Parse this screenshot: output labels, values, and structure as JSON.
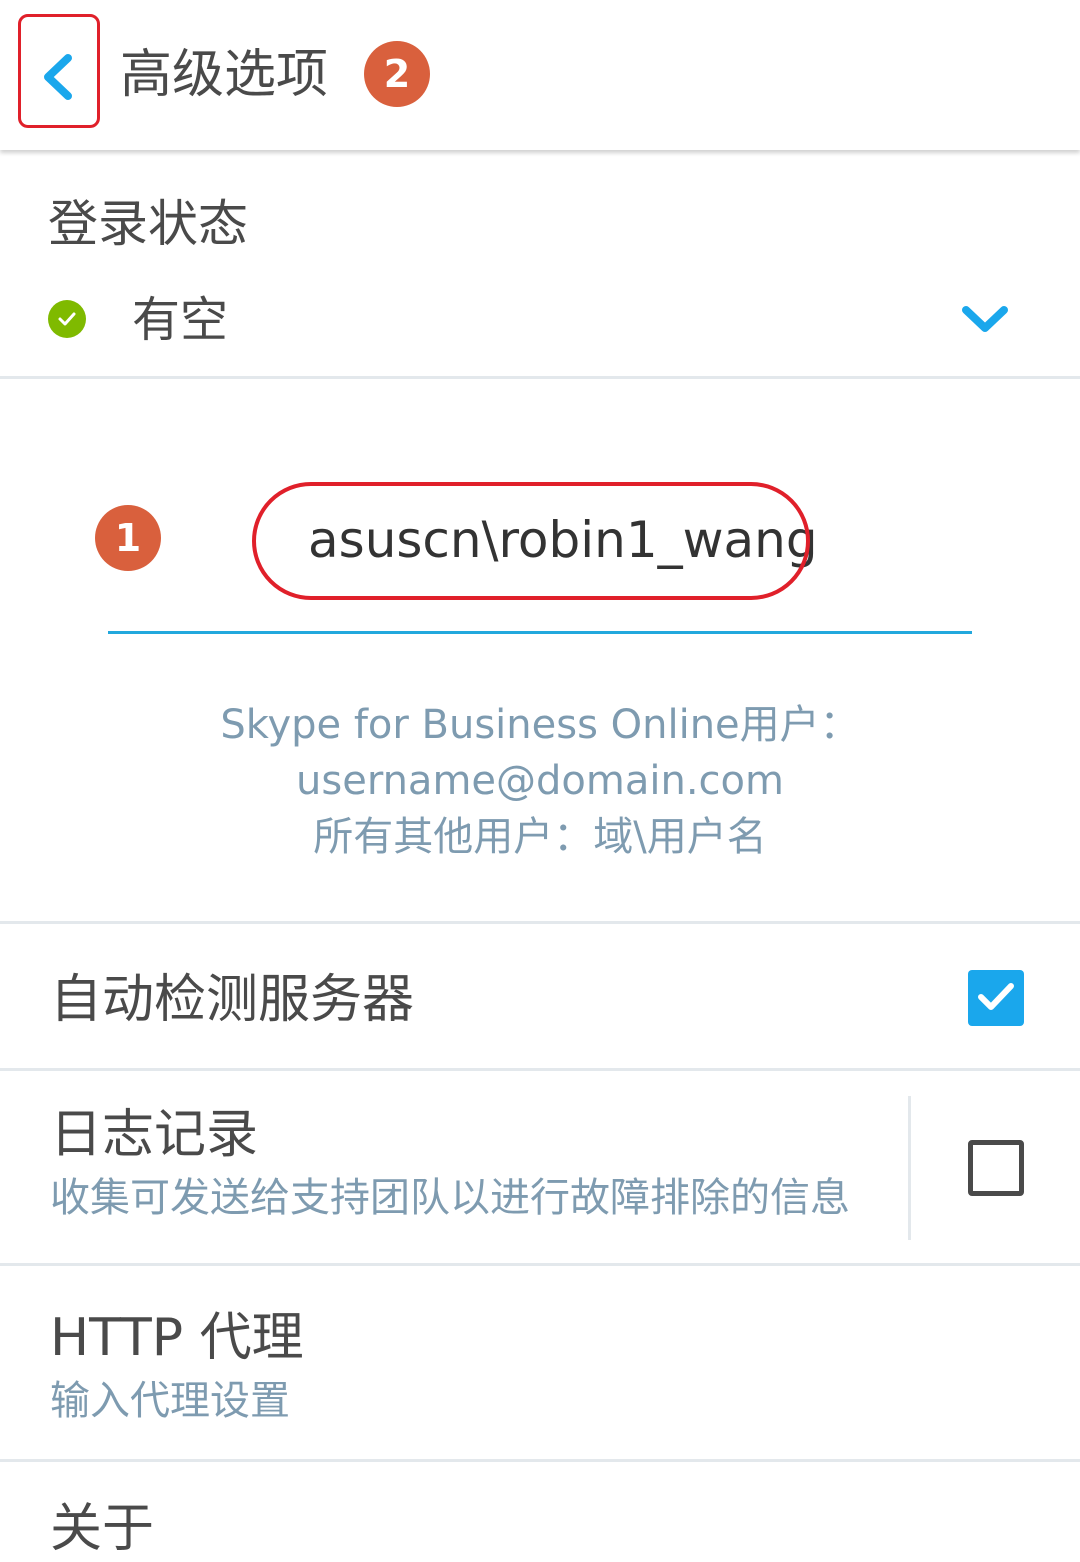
{
  "header": {
    "title": "高级选项",
    "back_icon": "chevron-left-icon",
    "step_badge": "2"
  },
  "sign_in_status": {
    "section_title": "登录状态",
    "status_label": "有空",
    "status_color": "#7fba00",
    "dropdown_icon": "chevron-down-icon"
  },
  "username": {
    "step_badge": "1",
    "value": "asuscn\\robin1_wang",
    "hint_line1": "Skype for Business Online用户：",
    "hint_line2": "username@domain.com",
    "hint_line3": "所有其他用户：域\\用户名"
  },
  "settings": {
    "auto_detect_server": {
      "label": "自动检测服务器",
      "checked": true
    },
    "logging": {
      "label": "日志记录",
      "description": "收集可发送给支持团队以进行故障排除的信息",
      "checked": false
    },
    "http_proxy": {
      "label": "HTTP 代理",
      "description": "输入代理设置"
    },
    "next_item_partial": "关于"
  },
  "colors": {
    "accent": "#1aa7ec",
    "annotation_red": "#e0202a",
    "badge_orange": "#d9603d",
    "hint_text": "#7e9bb0"
  }
}
